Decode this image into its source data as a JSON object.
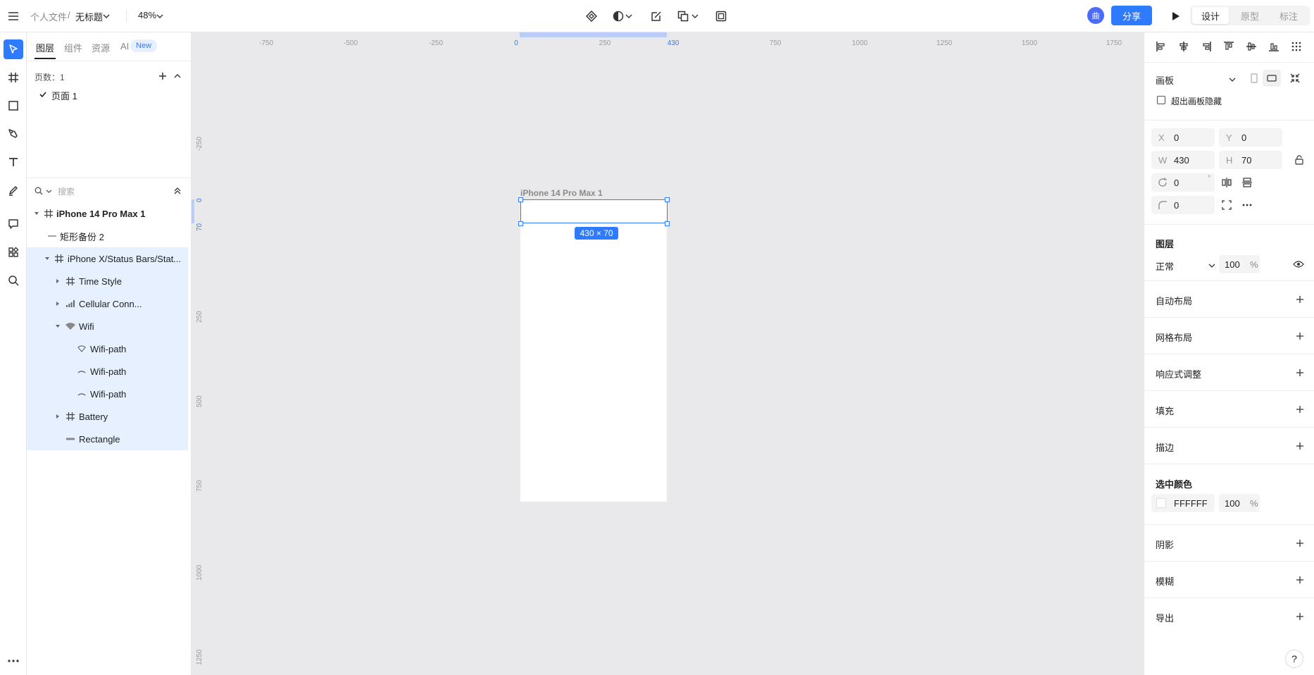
{
  "topbar": {
    "breadcrumb_root": "个人文件",
    "breadcrumb_sep": "/",
    "file_name": "无标题",
    "zoom": "48%",
    "avatar_text": "曲",
    "share_label": "分享",
    "modes": [
      "设计",
      "原型",
      "标注"
    ],
    "active_mode": "设计"
  },
  "layers_panel": {
    "tabs": [
      "图层",
      "组件",
      "资源",
      "AI"
    ],
    "new_badge": "New",
    "page_count_label": "页数：1",
    "pages": [
      "页面 1"
    ],
    "search_placeholder": "搜索",
    "tree": [
      {
        "name": "iPhone 14 Pro Max 1",
        "icon": "frame-icon"
      },
      {
        "name": "矩形备份 2",
        "icon": "line-icon"
      },
      {
        "name": "iPhone X/Status Bars/Stat...",
        "icon": "frame-icon"
      },
      {
        "name": "Time Style",
        "icon": "frame-icon"
      },
      {
        "name": "Cellular Conn...",
        "icon": "cellular-icon"
      },
      {
        "name": "Wifi",
        "icon": "wifi-icon"
      },
      {
        "name": "Wifi-path",
        "icon": "wifi-path-icon"
      },
      {
        "name": "Wifi-path",
        "icon": "arc-icon"
      },
      {
        "name": "Wifi-path",
        "icon": "arc-icon"
      },
      {
        "name": "Battery",
        "icon": "frame-icon"
      },
      {
        "name": "Rectangle",
        "icon": "rect-thin-icon"
      }
    ]
  },
  "canvas": {
    "h_ticks": [
      "-750",
      "-500",
      "-250",
      "0",
      "250",
      "430",
      "750",
      "1000",
      "1250",
      "1500",
      "1750"
    ],
    "v_ticks": [
      "-250",
      "0",
      "70",
      "250",
      "500",
      "750",
      "1000",
      "1250"
    ],
    "artboard_label": "iPhone 14 Pro Max 1",
    "selection_dim": "430 × 70"
  },
  "inspector": {
    "artboard_type": "画板",
    "clip_label": "超出画板隐藏",
    "x_label": "X",
    "x": "0",
    "y_label": "Y",
    "y": "0",
    "w_label": "W",
    "w": "430",
    "h_label": "H",
    "h": "70",
    "rotation": "0",
    "rotation_unit": "°",
    "radius": "0",
    "layer_title": "图层",
    "blend_mode": "正常",
    "opacity": "100",
    "percent": "%",
    "auto_layout": "自动布局",
    "grid_layout": "网格布局",
    "responsive": "响应式调整",
    "fill": "填充",
    "stroke": "描边",
    "selected_colors": "选中颜色",
    "color_hex": "FFFFFF",
    "color_opacity": "100",
    "shadow": "阴影",
    "blur": "模糊",
    "export": "导出"
  },
  "help_label": "?"
}
